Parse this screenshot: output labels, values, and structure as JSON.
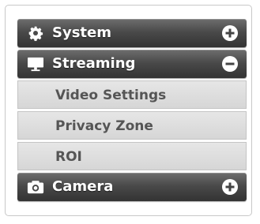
{
  "menu": {
    "system": {
      "label": "System",
      "icon": "gear-icon",
      "toggle": "plus-icon",
      "expanded": false
    },
    "streaming": {
      "label": "Streaming",
      "icon": "monitor-icon",
      "toggle": "minus-icon",
      "expanded": true,
      "items": [
        {
          "label": "Video Settings"
        },
        {
          "label": "Privacy Zone"
        },
        {
          "label": "ROI"
        }
      ]
    },
    "camera": {
      "label": "Camera",
      "icon": "camera-icon",
      "toggle": "plus-icon",
      "expanded": false
    }
  },
  "colors": {
    "header_top": "#6e6e6e",
    "header_bottom": "#333333",
    "sub_bg": "#dcdcdc",
    "sub_text": "#555555",
    "header_text": "#ffffff"
  }
}
